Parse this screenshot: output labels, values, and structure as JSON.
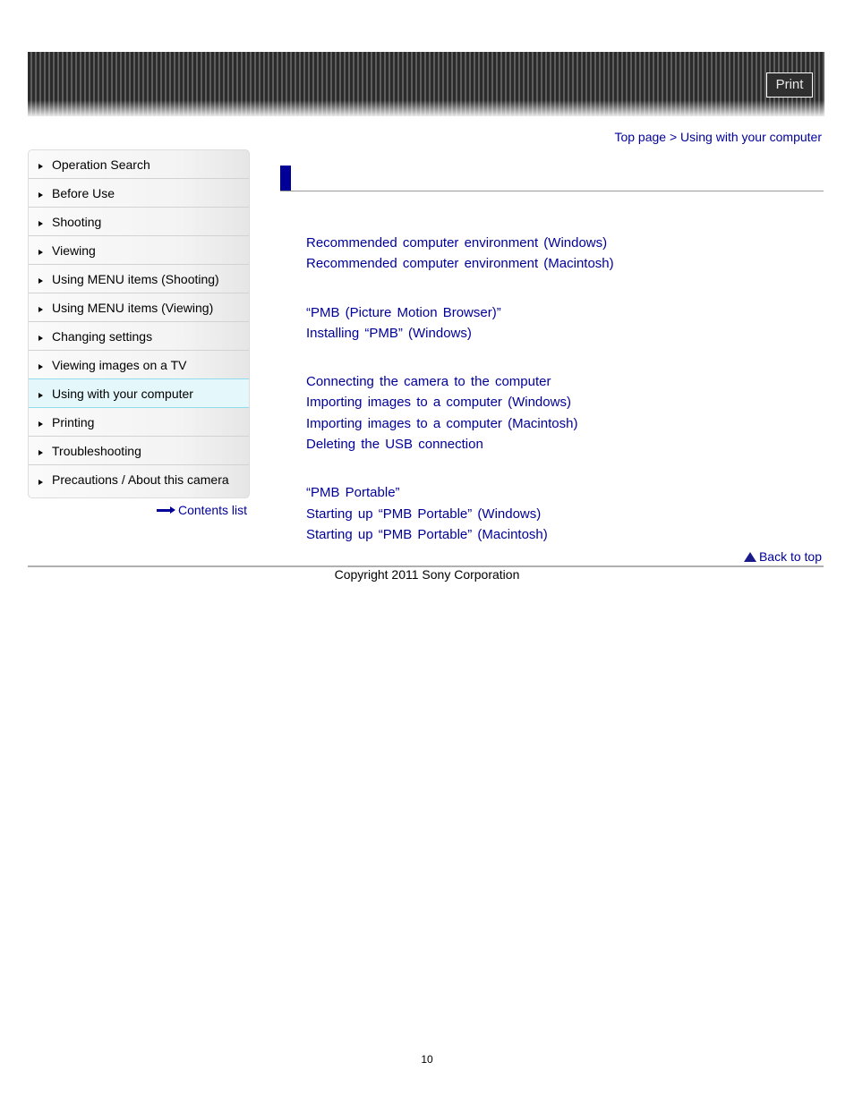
{
  "header": {
    "print_label": "Print"
  },
  "breadcrumb": {
    "items": [
      "Top page",
      "Using with your computer"
    ],
    "separator": " > "
  },
  "sidebar": {
    "items": [
      {
        "label": "Operation Search"
      },
      {
        "label": "Before Use"
      },
      {
        "label": "Shooting"
      },
      {
        "label": "Viewing"
      },
      {
        "label": "Using MENU items (Shooting)"
      },
      {
        "label": "Using MENU items (Viewing)"
      },
      {
        "label": "Changing settings"
      },
      {
        "label": "Viewing images on a TV"
      },
      {
        "label": "Using with your computer",
        "active": true
      },
      {
        "label": "Printing"
      },
      {
        "label": "Troubleshooting"
      },
      {
        "label": "Precautions / About this camera"
      }
    ],
    "contents_list": "Contents list"
  },
  "main": {
    "groups": [
      {
        "links": [
          "Recommended computer environment (Windows)",
          "Recommended computer environment (Macintosh)"
        ]
      },
      {
        "links": [
          "“PMB (Picture Motion Browser)”",
          "Installing “PMB” (Windows)"
        ]
      },
      {
        "links": [
          "Connecting the camera to the computer",
          "Importing images to a computer (Windows)",
          "Importing images to a computer (Macintosh)",
          "Deleting the USB connection"
        ]
      },
      {
        "links": [
          "“PMB Portable”",
          "Starting up “PMB Portable” (Windows)",
          "Starting up “PMB Portable” (Macintosh)"
        ]
      }
    ],
    "back_to_top": "Back to top"
  },
  "footer": {
    "copyright": "Copyright 2011 Sony Corporation",
    "page_number": "10"
  },
  "colors": {
    "link": "#000099",
    "active_item_bg": "#e4f8fb",
    "active_item_border": "#8fdcec"
  }
}
